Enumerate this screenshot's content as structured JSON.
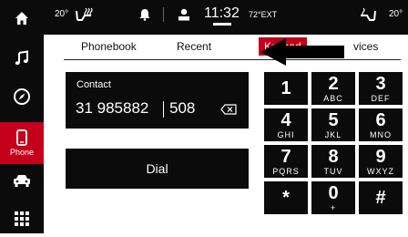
{
  "status_bar": {
    "temp_left": "20°",
    "time": "11:32",
    "ext_temp": "72°EXT",
    "temp_right": "20°"
  },
  "sidebar": {
    "items": [
      {
        "name": "home",
        "label": ""
      },
      {
        "name": "music",
        "label": ""
      },
      {
        "name": "navigation",
        "label": ""
      },
      {
        "name": "phone",
        "label": "Phone",
        "active": true
      },
      {
        "name": "vehicle",
        "label": ""
      },
      {
        "name": "apps",
        "label": ""
      }
    ]
  },
  "tabs": [
    {
      "label": "Phonebook"
    },
    {
      "label": "Recent"
    },
    {
      "label": "Keypad",
      "active": true
    },
    {
      "label": "vices"
    }
  ],
  "contact": {
    "label": "Contact",
    "number": "31 985882",
    "extension": "508"
  },
  "dial_button": {
    "label": "Dial"
  },
  "keypad": [
    {
      "digit": "1",
      "letters": ""
    },
    {
      "digit": "2",
      "letters": "ABC"
    },
    {
      "digit": "3",
      "letters": "DEF"
    },
    {
      "digit": "4",
      "letters": "GHI"
    },
    {
      "digit": "5",
      "letters": "JKL"
    },
    {
      "digit": "6",
      "letters": "MNO"
    },
    {
      "digit": "7",
      "letters": "PQRS"
    },
    {
      "digit": "8",
      "letters": "TUV"
    },
    {
      "digit": "9",
      "letters": "WXYZ"
    },
    {
      "digit": "*",
      "letters": ""
    },
    {
      "digit": "0",
      "letters": "+"
    },
    {
      "digit": "#",
      "letters": ""
    }
  ],
  "colors": {
    "accent": "#c4001a",
    "panel": "#0b0b0b"
  }
}
